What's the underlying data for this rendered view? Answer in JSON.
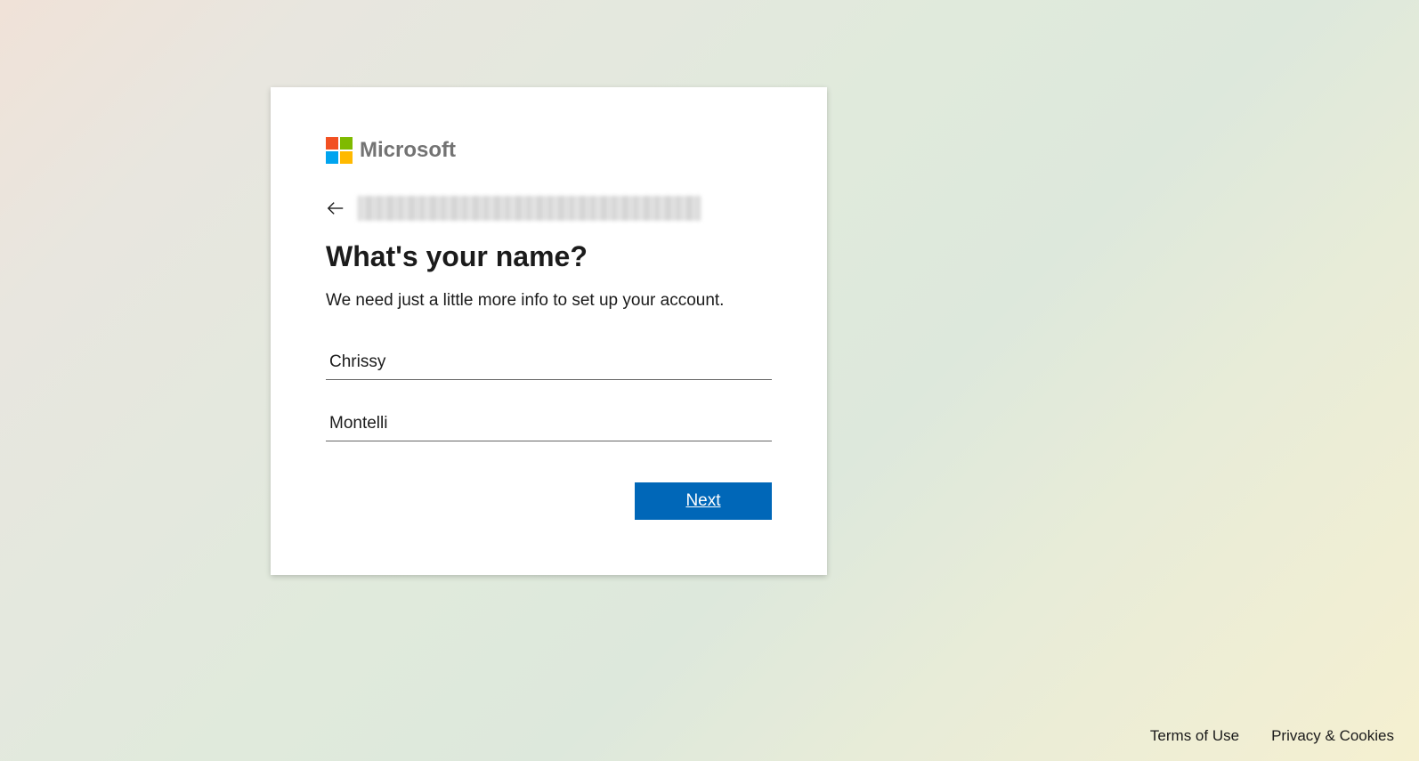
{
  "logo": {
    "text": "Microsoft"
  },
  "heading": "What's your name?",
  "subtext": "We need just a little more info to set up your account.",
  "form": {
    "first_name_value": "Chrissy",
    "last_name_value": "Montelli"
  },
  "buttons": {
    "next": "Next"
  },
  "footer": {
    "terms": "Terms of Use",
    "privacy": "Privacy & Cookies"
  }
}
